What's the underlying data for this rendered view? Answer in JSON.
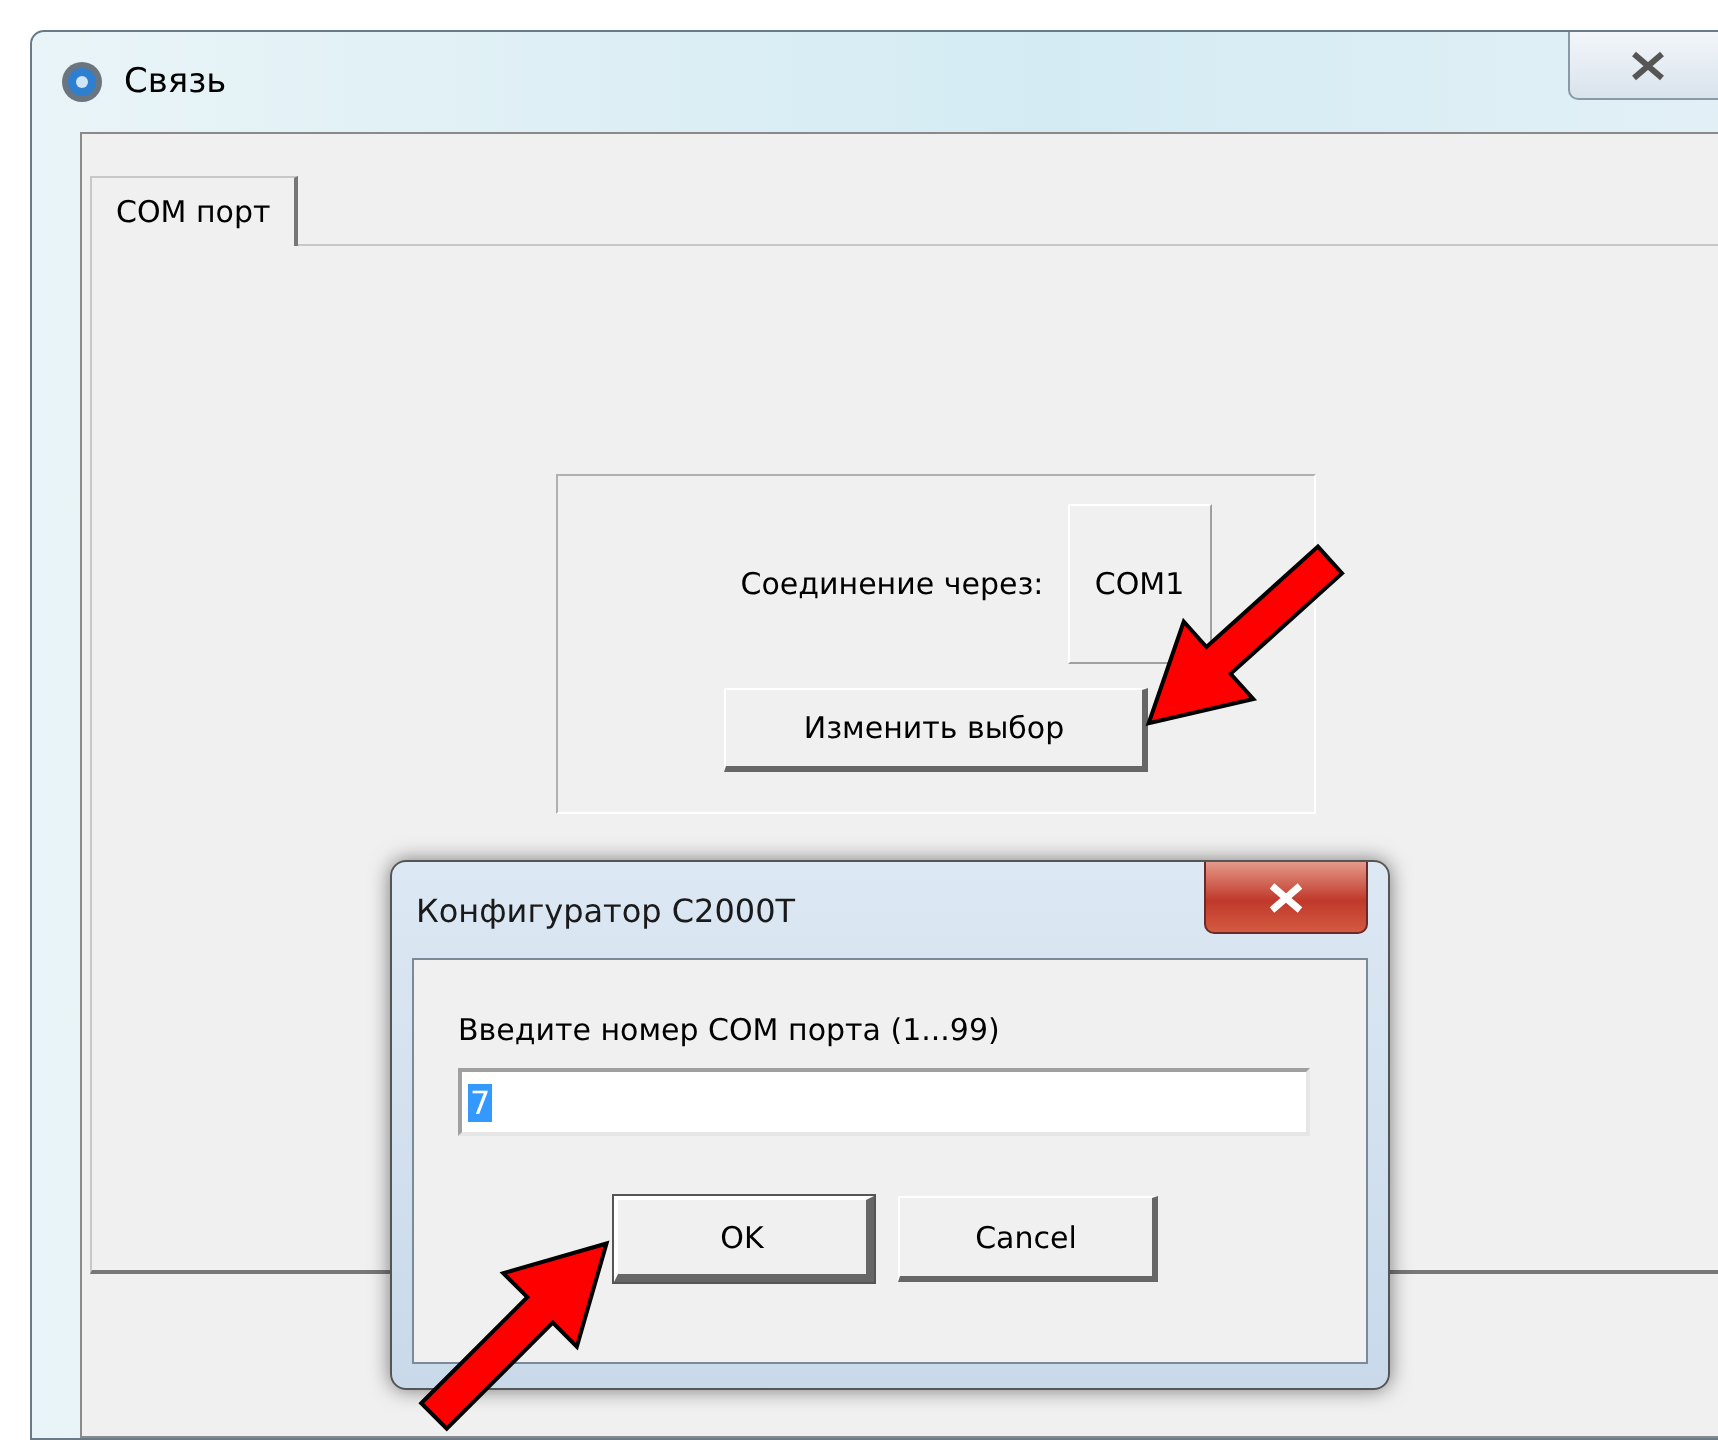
{
  "window": {
    "title": "Связь"
  },
  "tabs": [
    {
      "label": "COM порт",
      "selected": true
    }
  ],
  "connection": {
    "label": "Соединение через:",
    "port": "COM1",
    "button": "Изменить выбор"
  },
  "dialog": {
    "title": "Конфигуратор С2000Т",
    "prompt": "Введите номер COM порта (1...99)",
    "field": {
      "value": "7",
      "text_selected": true
    },
    "buttons": [
      {
        "label": "OK",
        "default": true
      },
      {
        "label": "Cancel",
        "default": false
      }
    ]
  }
}
